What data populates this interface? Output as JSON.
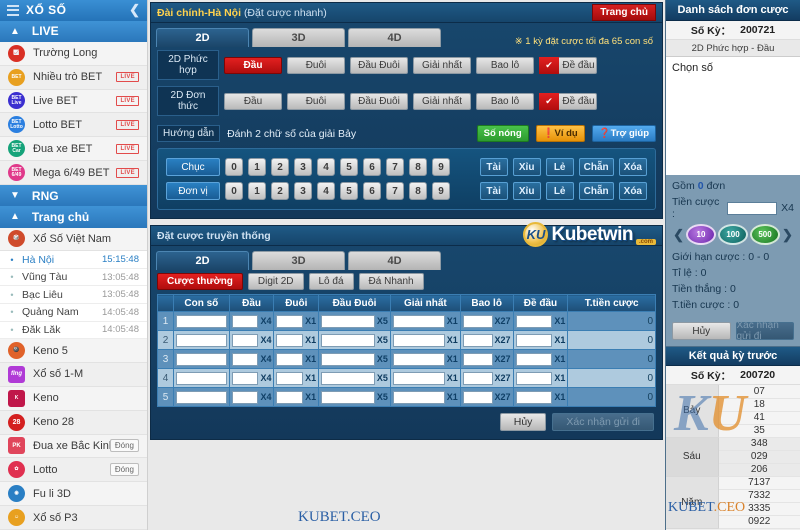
{
  "sidebar": {
    "title": "XỔ SỐ",
    "sections": [
      {
        "label": "LIVE",
        "caret": "▲"
      },
      {
        "label": "RNG",
        "caret": "▼"
      },
      {
        "label": "Trang chủ",
        "caret": "▲"
      }
    ],
    "live_items": [
      {
        "label": "Trường Long",
        "icon": "chart-icon",
        "icon_text": "",
        "color": "#d93025",
        "badge": ""
      },
      {
        "label": "Nhiều trò BET",
        "icon": "bet-icon",
        "icon_text": "BET",
        "color": "#e8a020",
        "badge": "LIVE"
      },
      {
        "label": "Live BET",
        "icon": "bet-live-icon",
        "icon_text": "BET Live",
        "color": "#3b2fd0",
        "badge": "LIVE"
      },
      {
        "label": "Lotto BET",
        "icon": "bet-lotto-icon",
        "icon_text": "BET Lotto",
        "color": "#2b7fe0",
        "badge": "LIVE"
      },
      {
        "label": "Đua xe BET",
        "icon": "bet-car-icon",
        "icon_text": "BET Car",
        "color": "#16a37a",
        "badge": "LIVE"
      },
      {
        "label": "Mega 6/49 BET",
        "icon": "bet-mega-icon",
        "icon_text": "BET 6/49",
        "color": "#e0398a",
        "badge": "LIVE"
      }
    ],
    "home_items": [
      {
        "label": "Xổ Số Việt Nam",
        "icon": "vn-lottery-icon",
        "icon_text": "",
        "color": "#cf4b2c",
        "badge": ""
      }
    ],
    "regions": [
      {
        "name": "Hà Nội",
        "time": "15:15:48",
        "active": true
      },
      {
        "name": "Vũng Tàu",
        "time": "13:05:48",
        "active": false
      },
      {
        "name": "Bạc Liêu",
        "time": "13:05:48",
        "active": false
      },
      {
        "name": "Quảng Nam",
        "time": "14:05:48",
        "active": false
      },
      {
        "name": "Đăk Lăk",
        "time": "14:05:48",
        "active": false
      }
    ],
    "games": [
      {
        "label": "Keno 5",
        "icon": "keno5-icon",
        "icon_text": "",
        "color": "#e0622a",
        "badge": ""
      },
      {
        "label": "Xổ số 1-M",
        "icon": "xoso1m-icon",
        "icon_text": "",
        "color": "#b03ad6",
        "badge": ""
      },
      {
        "label": "Keno",
        "icon": "keno-icon",
        "icon_text": "",
        "color": "#c0174a",
        "badge": ""
      },
      {
        "label": "Keno 28",
        "icon": "keno28-icon",
        "icon_text": "28",
        "color": "#d42020",
        "badge": ""
      },
      {
        "label": "Đua xe Bắc Kinh",
        "icon": "beijing-race-icon",
        "icon_text": "",
        "color": "#e0455b",
        "badge": "Đóng"
      },
      {
        "label": "Lotto",
        "icon": "lotto-icon",
        "icon_text": "",
        "color": "#e03050",
        "badge": "Đóng"
      },
      {
        "label": "Fu li 3D",
        "icon": "fuli3d-icon",
        "icon_text": "",
        "color": "#2a7fc4",
        "badge": ""
      },
      {
        "label": "Xổ số P3",
        "icon": "xosop3-icon",
        "icon_text": "",
        "color": "#e8a020",
        "badge": ""
      }
    ]
  },
  "main": {
    "header": {
      "title": "Đài chính-Hà Nội",
      "subtitle": "(Đặt cược nhanh)",
      "home_button": "Trang chủ"
    },
    "tabs": [
      {
        "label": "2D",
        "selected": true
      },
      {
        "label": "3D",
        "selected": false
      },
      {
        "label": "4D",
        "selected": false
      }
    ],
    "tab_note": "※ 1 kỳ đặt cược tối đa 65 con số",
    "bet_rows": [
      {
        "label": "2D Phức hợp",
        "buttons": [
          {
            "label": "Đầu",
            "style": "red"
          },
          {
            "label": "Đuôi",
            "style": "gray"
          },
          {
            "label": "Đầu Đuôi",
            "style": "gray"
          },
          {
            "label": "Giải nhất",
            "style": "gray"
          },
          {
            "label": "Bao lô",
            "style": "gray"
          },
          {
            "label": "Đề đầu",
            "style": "dedau"
          }
        ]
      },
      {
        "label": "2D Đơn thức",
        "buttons": [
          {
            "label": "Đầu",
            "style": "gray"
          },
          {
            "label": "Đuôi",
            "style": "gray"
          },
          {
            "label": "Đầu Đuôi",
            "style": "gray"
          },
          {
            "label": "Giải nhất",
            "style": "gray"
          },
          {
            "label": "Bao lô",
            "style": "gray"
          },
          {
            "label": "Đề đầu",
            "style": "dedau"
          }
        ]
      }
    ],
    "guide": {
      "label": "Hướng dẫn",
      "text": "Đánh 2 chữ số của giải Bảy",
      "hot_numbers": "Số nóng",
      "example": "Ví dụ",
      "help": "Trợ giúp"
    },
    "numpad": {
      "digits": [
        "0",
        "1",
        "2",
        "3",
        "4",
        "5",
        "6",
        "7",
        "8",
        "9"
      ],
      "rows": [
        {
          "label": "Chục",
          "actions": [
            "Tài",
            "Xỉu",
            "Lẻ",
            "Chẵn",
            "Xóa"
          ]
        },
        {
          "label": "Đơn vị",
          "actions": [
            "Tài",
            "Xỉu",
            "Lẻ",
            "Chẵn",
            "Xóa"
          ]
        }
      ]
    },
    "traditional": {
      "header": "Đặt cược truyền thống",
      "brand": {
        "mark": "KU",
        "name": "Kubetwin",
        "tld": ".com"
      },
      "tabs": [
        {
          "label": "2D",
          "selected": true
        },
        {
          "label": "3D",
          "selected": false
        },
        {
          "label": "4D",
          "selected": false
        }
      ],
      "subtabs": [
        {
          "label": "Cược thường",
          "style": "red"
        },
        {
          "label": "Digit 2D",
          "style": "gray"
        },
        {
          "label": "Lô đá",
          "style": "gray"
        },
        {
          "label": "Đá Nhanh",
          "style": "gray"
        }
      ],
      "columns": [
        "",
        "Con số",
        "Đầu",
        "Đuôi",
        "Đầu Đuôi",
        "Giải nhất",
        "Bao lô",
        "Đề đầu",
        "T.tiền cược"
      ],
      "multipliers": [
        "X4",
        "X1",
        "X5",
        "X1",
        "X27",
        "X1"
      ],
      "rows": [
        {
          "index": "1",
          "values": [
            "",
            "",
            "",
            "",
            "",
            "",
            ""
          ],
          "total": "0"
        },
        {
          "index": "2",
          "values": [
            "",
            "",
            "",
            "",
            "",
            "",
            ""
          ],
          "total": "0"
        },
        {
          "index": "3",
          "values": [
            "",
            "",
            "",
            "",
            "",
            "",
            ""
          ],
          "total": "0"
        },
        {
          "index": "4",
          "values": [
            "",
            "",
            "",
            "",
            "",
            "",
            ""
          ],
          "total": "0"
        },
        {
          "index": "5",
          "values": [
            "",
            "",
            "",
            "",
            "",
            "",
            ""
          ],
          "total": "0"
        }
      ],
      "cancel_button": "Hủy",
      "confirm_button": "Xác nhận gửi đi"
    }
  },
  "right": {
    "orders": {
      "title": "Danh sách đơn cược",
      "period_label": "Số Kỳ：",
      "period_value": "200721",
      "bet_type": "2D Phức hợp - Đầu",
      "placeholder": "Chọn số",
      "summary_prefix": "Gồm",
      "summary_count": "0",
      "summary_suffix": "đơn",
      "amount_label": "Tiền cược :",
      "amount_value": "",
      "amount_multiplier": "X4",
      "chips": [
        {
          "value": "10",
          "color": "purple"
        },
        {
          "value": "100",
          "color": "teal"
        },
        {
          "value": "500",
          "color": "green"
        }
      ],
      "limit_label": "Giới hạn cược :",
      "limit_value": "0 - 0",
      "rate_label": "Tỉ        lệ :",
      "rate_value": "0",
      "win_label": "Tiền thắng :",
      "win_value": "0",
      "total_label": "T.tiền cược :",
      "total_value": "0",
      "cancel_button": "Hủy",
      "confirm_button": "Xác nhận gửi đi"
    },
    "results": {
      "title": "Kết quả kỳ trước",
      "period_label": "Số Kỳ：",
      "period_value": "200720",
      "groups": [
        {
          "name": "Bảy",
          "numbers": [
            "07",
            "18",
            "41",
            "35"
          ]
        },
        {
          "name": "Sáu",
          "numbers": [
            "348",
            "029",
            "206"
          ]
        },
        {
          "name": "Năm",
          "numbers": [
            "7137",
            "7332",
            "3335",
            "0922"
          ]
        }
      ]
    }
  },
  "watermark": {
    "mark": "KU",
    "text_left": "KUBET",
    "text_right": ".CEO",
    "center": "KUBET.CEO"
  }
}
